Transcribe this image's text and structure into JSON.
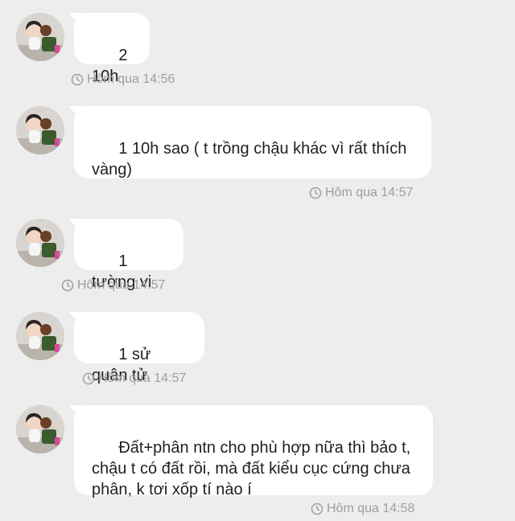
{
  "messages": [
    {
      "text": "2 10h",
      "time": "Hôm qua 14:56"
    },
    {
      "text": "1 10h sao ( t trồng chậu khác vì rất thích vàng)",
      "time": "Hôm qua 14:57"
    },
    {
      "text": "1 tường vi",
      "time": "Hôm qua 14:57"
    },
    {
      "text": "1 sử quân tử",
      "time": "Hôm qua 14:57"
    },
    {
      "text": "Đất+phân ntn cho phù hợp nữa thì bảo t, chậu t có đất rồi, mà đất kiểu cục cứng chưa phân, k tơi xốp tí nào í",
      "time": "Hôm qua 14:58"
    }
  ],
  "icons": {
    "timestamp": "clock-icon",
    "avatar": "avatar"
  },
  "colors": {
    "background": "#ededed",
    "bubble": "#ffffff",
    "meta_text": "#9e9e9e"
  }
}
